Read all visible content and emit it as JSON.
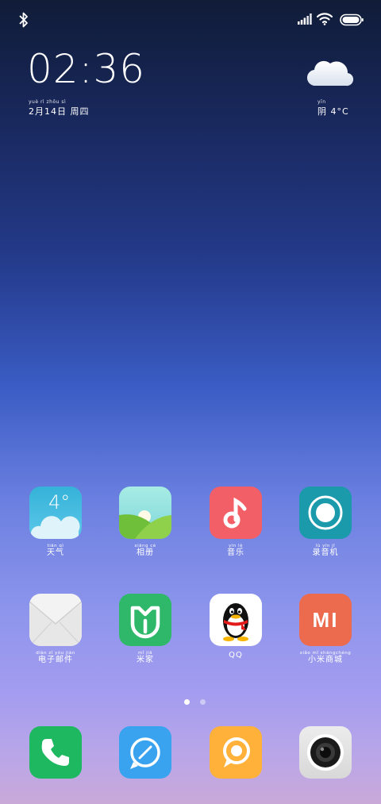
{
  "status": {
    "icons": [
      "bluetooth-icon",
      "signal-icon",
      "wifi-icon",
      "battery-icon"
    ]
  },
  "clock": {
    "time": "02:36",
    "date_pinyin": "yuè   rì   zhōu sì",
    "date": "2月14日 周四"
  },
  "weather": {
    "icon": "cloud-icon",
    "pinyin": "yīn",
    "text": "阴  4°C"
  },
  "apps": [
    {
      "name": "天气",
      "pinyin": "tiān qì",
      "icon": "weather-app-icon",
      "color": "#39b4dc",
      "temp": "4°"
    },
    {
      "name": "相册",
      "pinyin": "xiāng cè",
      "icon": "gallery-icon",
      "color": "#8be0d8"
    },
    {
      "name": "音乐",
      "pinyin": "yīn  lè",
      "icon": "music-icon",
      "color": "#f25f67"
    },
    {
      "name": "录音机",
      "pinyin": "lù  yīn  jī",
      "icon": "recorder-icon",
      "color": "#1a9aab"
    },
    {
      "name": "电子邮件",
      "pinyin": "diàn  zǐ  yóu  jiàn",
      "icon": "email-icon",
      "color": "#f2f2f2"
    },
    {
      "name": "米家",
      "pinyin": "mǐ  jiā",
      "icon": "mijia-icon",
      "color": "#2fb86a"
    },
    {
      "name": "QQ",
      "pinyin": "",
      "icon": "qq-icon",
      "color": "#ffffff"
    },
    {
      "name": "小米商城",
      "pinyin": "xiǎo  mǐ  shāngchéng",
      "icon": "mi-store-icon",
      "color": "#ec6a4e",
      "logo": "MI"
    }
  ],
  "dock": [
    {
      "icon": "phone-icon",
      "color": "#1db860"
    },
    {
      "icon": "messages-icon",
      "color": "#3aa3f0"
    },
    {
      "icon": "chat-bubble-icon",
      "color": "#ffb13a"
    },
    {
      "icon": "camera-icon",
      "color": "#e6e6e6"
    }
  ],
  "pages": {
    "count": 2,
    "current": 1
  }
}
